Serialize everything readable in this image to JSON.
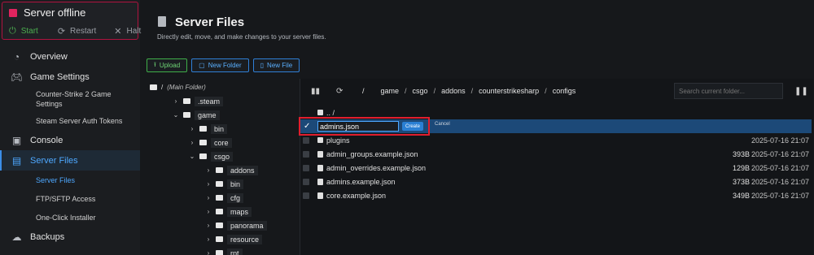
{
  "server": {
    "status": "Server offline",
    "start_label": "Start",
    "restart_label": "Restart",
    "halt_label": "Halt"
  },
  "nav": {
    "overview": "Overview",
    "game_settings": "Game Settings",
    "cs2_settings": "Counter-Strike 2 Game Settings",
    "steam_auth": "Steam Server Auth Tokens",
    "console": "Console",
    "server_files": "Server Files",
    "server_files_sub": "Server Files",
    "ftp": "FTP/SFTP Access",
    "installer": "One-Click Installer",
    "backups": "Backups"
  },
  "header": {
    "title": "Server Files",
    "subtitle": "Directly edit, move, and make changes to your server files."
  },
  "toolbar": {
    "upload": "Upload",
    "new_folder": "New Folder",
    "new_file": "New File"
  },
  "tree": {
    "root_slash": "/",
    "root_label": "(Main Folder)",
    "steam": ".steam",
    "game": "game",
    "bin": "bin",
    "core": "core",
    "csgo": "csgo",
    "addons": "addons",
    "csgo_bin": "bin",
    "cfg": "cfg",
    "maps": "maps",
    "panorama": "panorama",
    "resource": "resource",
    "rpt": "rpt"
  },
  "path": {
    "root": "/",
    "segments": [
      "game",
      "csgo",
      "addons",
      "counterstrikesharp",
      "configs"
    ],
    "search_placeholder": "Search current folder..."
  },
  "files": {
    "parent": ".. /",
    "new_value": "admins.json",
    "create_label": "Create",
    "cancel_label": "Cancel",
    "rows": [
      {
        "name": "plugins",
        "size": "",
        "date": "2025-07-16 21:07"
      },
      {
        "name": "admin_groups.example.json",
        "size": "393B",
        "date": "2025-07-16 21:07"
      },
      {
        "name": "admin_overrides.example.json",
        "size": "129B",
        "date": "2025-07-16 21:07"
      },
      {
        "name": "admins.example.json",
        "size": "373B",
        "date": "2025-07-16 21:07"
      },
      {
        "name": "core.example.json",
        "size": "349B",
        "date": "2025-07-16 21:07"
      }
    ]
  },
  "colors": {
    "accent": "#3b8ee8",
    "offline": "#e0245e",
    "start": "#4caf50",
    "highlight": "#e01e2e"
  }
}
